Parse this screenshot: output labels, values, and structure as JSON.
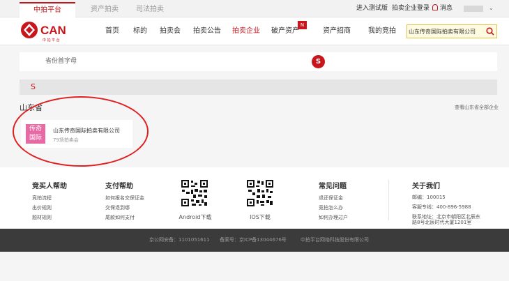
{
  "top_tabs": [
    "中拍平台",
    "资产拍卖",
    "司法拍卖"
  ],
  "top_right": {
    "test_version": "进入测试版",
    "company_login": "拍卖企业登录",
    "messages": "消息"
  },
  "logo": {
    "text": "CAN",
    "subtext": "中 拍 平 台"
  },
  "nav": [
    "首页",
    "标的",
    "拍卖会",
    "拍卖公告",
    "拍卖企业",
    "破产资产",
    "资产招商",
    "我的竞拍"
  ],
  "nav_badge": "N",
  "search": {
    "value": "山东传奇国际拍卖有限公司"
  },
  "filter": {
    "label": "省份首字母",
    "selected_letter": "S"
  },
  "letter_section": "S",
  "province": {
    "name": "山东省",
    "view_all": "查看山东省全部企业"
  },
  "company": {
    "logo_line1": "传奇",
    "logo_line2": "国际",
    "name": "山东传奇国际拍卖有限公司",
    "count": "79场拍卖会"
  },
  "footer": {
    "buyer_help": {
      "title": "竞买人帮助",
      "links": [
        "竞拍流程",
        "出价规则",
        "题材规则"
      ]
    },
    "payment_help": {
      "title": "支付帮助",
      "links": [
        "如何报名交保证金",
        "交保退到哪",
        "尾款如何支付"
      ]
    },
    "android": "Android下载",
    "ios": "IOS下载",
    "faq": {
      "title": "常见问题",
      "links": [
        "退还保证金",
        "竞拍怎么办",
        "如何办理过户"
      ]
    },
    "about": {
      "title": "关于我们",
      "postcode": "邮编：100015",
      "hotline": "客服专线：400-896-5988",
      "address1": "联系地址：北京市朝阳区北辰东",
      "address2": "路8号北辰时代大厦1201室"
    }
  },
  "copyright": {
    "police": "京公网安备：1101051611",
    "icp": "备案号：京ICP备13044676号",
    "company": "中拍平台网络科技股份有限公司"
  },
  "colors": {
    "brand": "#c8161d",
    "company_logo": "#e86aa5",
    "annotation": "#e02020"
  }
}
